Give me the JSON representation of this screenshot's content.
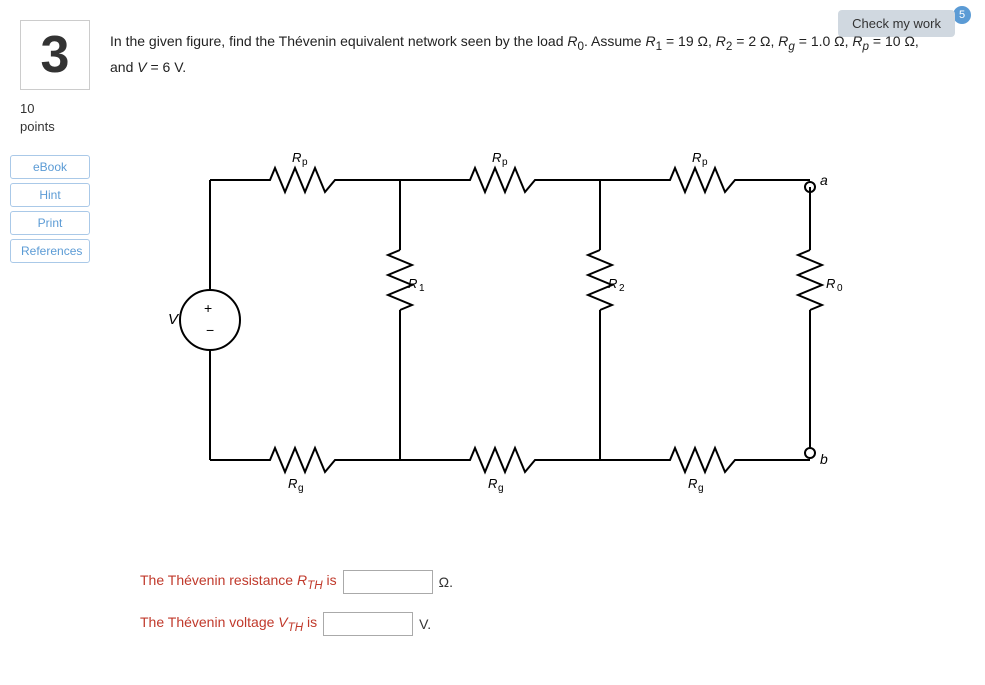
{
  "badge": "5",
  "check_button": "Check my work",
  "question_number": "3",
  "points_value": "10",
  "points_label": "points",
  "question_text_line1": "In the given figure, find the Thévenin equivalent network seen by the load R",
  "question_text_line2": ". Assume R",
  "question_params": "= 19 Ω, R₂ = 2 Ω, Rg = 1.0 Ω, Rp = 10 Ω, and V = 6 V.",
  "sidebar": {
    "ebook": "eBook",
    "hint": "Hint",
    "print": "Print",
    "references": "References"
  },
  "answer": {
    "rth_label": "The Thévenin resistance R",
    "rth_subscript": "TH",
    "rth_suffix": "is",
    "rth_unit": "Ω.",
    "vth_label": "The Thévenin voltage V",
    "vth_subscript": "TH",
    "vth_suffix": "is",
    "vth_unit": "V."
  }
}
